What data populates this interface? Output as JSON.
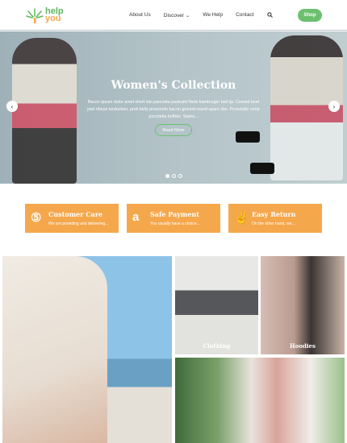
{
  "header": {
    "logo": {
      "line1": "help",
      "line2": "you"
    },
    "nav": [
      "About Us",
      "Discover ⌄",
      "We Help",
      "Contact"
    ],
    "search_icon": "search-icon",
    "shop_label": "Shop"
  },
  "hero": {
    "title": "Women's Collection",
    "text": "Bacon ipsum dolor amet short loin pancetta pastrami flank hamburger ball tip. Corned beef jowl ribeye turducken, pork belly prosciutto bacon ground round spare ribs. Prosciutto rump porchetta buffalo. Swine...",
    "button": "Read More",
    "prev": "‹",
    "next": "›",
    "slides": 3,
    "active_slide": 1
  },
  "features": [
    {
      "icon": "support-icon",
      "glyph": "⑤",
      "title": "Customer Care",
      "text": "We are providing and delivering..."
    },
    {
      "icon": "amazon-icon",
      "glyph": "a",
      "title": "Safe Payment",
      "text": "You usually have a choice..."
    },
    {
      "icon": "peace-hand-icon",
      "glyph": "✌",
      "title": "Easy Return",
      "text": "On the other hand, we..."
    }
  ],
  "gallery": {
    "clothing": "Clothing",
    "hoodies": "Hoodies"
  },
  "colors": {
    "accent_green": "#6cc070",
    "accent_orange": "#f5a74c"
  }
}
